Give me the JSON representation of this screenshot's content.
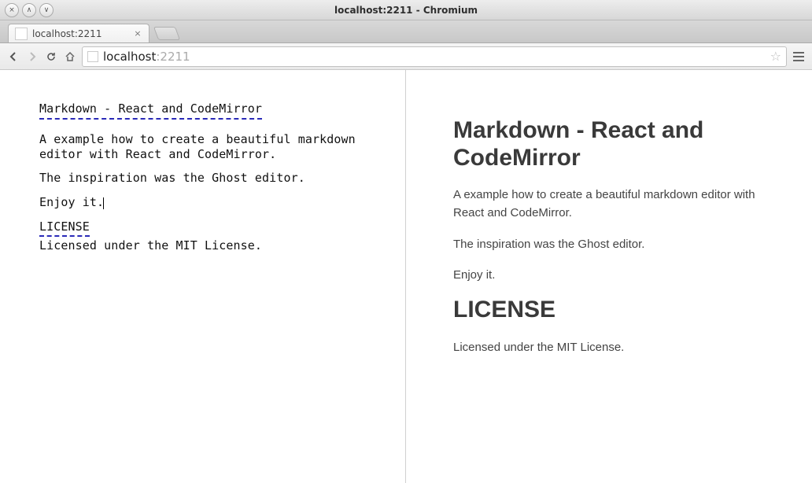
{
  "window": {
    "title": "localhost:2211 - Chromium",
    "buttons": {
      "close": "×",
      "min": "∧",
      "max": "∨"
    }
  },
  "tab": {
    "label": "localhost:2211",
    "close_glyph": "×"
  },
  "toolbar": {
    "back": "←",
    "forward": "→",
    "reload": "↻",
    "home": "⌂",
    "url_host": "localhost",
    "url_port": ":2211",
    "star": "☆"
  },
  "editor": {
    "h1": "Markdown - React and CodeMirror",
    "p1": "A example how to create a beautiful markdown editor with React and CodeMirror.",
    "p2": "The inspiration was the Ghost editor.",
    "p3": "Enjoy it.",
    "h2": "LICENSE",
    "p4": "Licensed under the MIT License."
  },
  "preview": {
    "h1": "Markdown - React and CodeMirror",
    "p1": "A example how to create a beautiful markdown editor with React and CodeMirror.",
    "p2": "The inspiration was the Ghost editor.",
    "p3": "Enjoy it.",
    "h2": "LICENSE",
    "p4": "Licensed under the MIT License."
  }
}
